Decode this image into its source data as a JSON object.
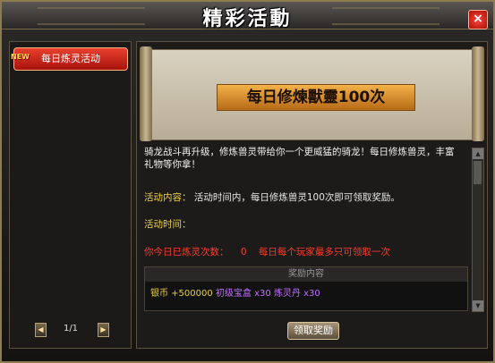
{
  "window": {
    "title": "精彩活動",
    "close_symbol": "×"
  },
  "sidebar": {
    "items": [
      {
        "label": "每日炼灵活动",
        "badge": "NEW"
      }
    ],
    "pager": {
      "prev_symbol": "◀",
      "next_symbol": "▶",
      "page": "1/1"
    }
  },
  "banner": {
    "title": "每日修煉獸靈100次"
  },
  "content": {
    "description": "骑龙战斗再升级，修炼兽灵带给你一个更威猛的骑龙！每日修炼兽灵，丰富礼物等你拿！",
    "activity_label": "活动内容：",
    "activity_text": "活动时间内，每日修炼兽灵100次即可领取奖励。",
    "time_label": "活动时间：",
    "time_text": "",
    "count_label": "你今日已炼灵次数：",
    "count_value": "0",
    "limit_text": "每日每个玩家最多只可领取一次"
  },
  "rewards": {
    "header": "奖励内容",
    "items": [
      {
        "text": "银币 +500000",
        "color": "#e8d040"
      },
      {
        "text": "初级宝盒 x30",
        "color": "#c070ff"
      },
      {
        "text": "炼灵丹 x30",
        "color": "#c070ff"
      }
    ]
  },
  "claim_button": "领取奖励",
  "colors": {
    "accent_red": "#e8402e",
    "label_yellow": "#f0d040",
    "count_red": "#ff3a2a",
    "frame_gold": "#8f7b52"
  }
}
